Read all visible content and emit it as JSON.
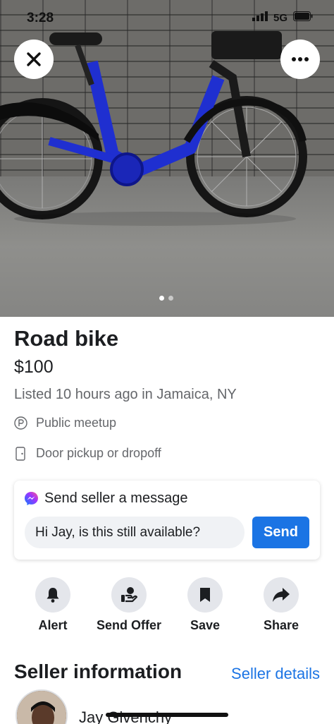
{
  "status_bar": {
    "time": "3:28",
    "network": "5G"
  },
  "photo": {
    "close_icon": "close-icon",
    "more_icon": "more-dots-icon",
    "pages": 2,
    "active_page": 1
  },
  "listing": {
    "title": "Road bike",
    "price": "$100",
    "listed": "Listed 10 hours ago in Jamaica, NY",
    "details": [
      {
        "icon": "parking-circle-icon",
        "label": "Public meetup"
      },
      {
        "icon": "door-icon",
        "label": "Door pickup or dropoff"
      }
    ]
  },
  "message": {
    "icon": "messenger-icon",
    "heading": "Send seller a message",
    "value": "Hi Jay, is this still available?",
    "send_label": "Send"
  },
  "actions": [
    {
      "icon": "bell-icon",
      "label": "Alert"
    },
    {
      "icon": "hand-offer-icon",
      "label": "Send Offer"
    },
    {
      "icon": "bookmark-icon",
      "label": "Save"
    },
    {
      "icon": "share-icon",
      "label": "Share"
    }
  ],
  "seller": {
    "heading": "Seller information",
    "link": "Seller details",
    "name": "Jay Givenchy"
  },
  "colors": {
    "accent": "#1b74e4",
    "bike": "#1f2fd0",
    "chip": "#e4e6eb"
  }
}
